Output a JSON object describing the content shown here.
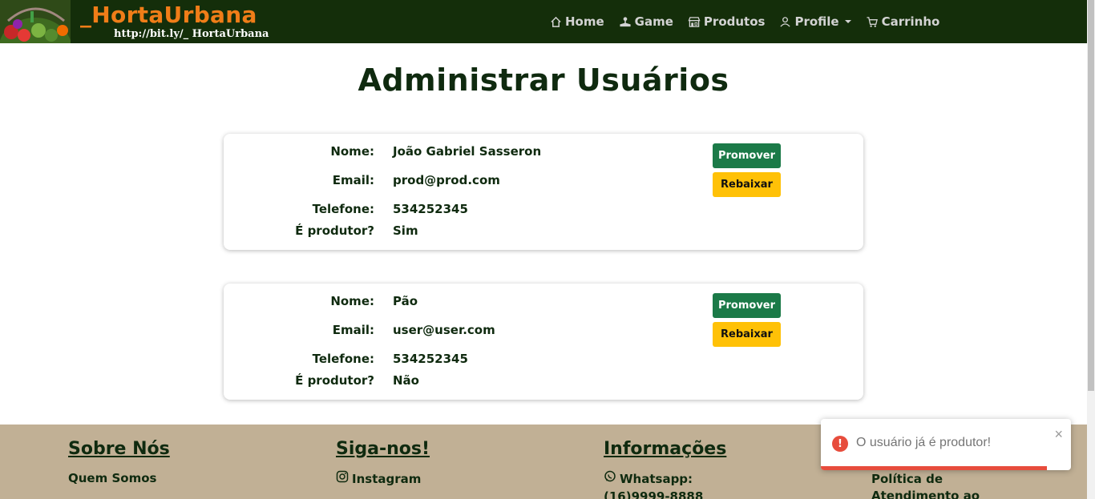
{
  "nav": {
    "logo_title": "_HortaUrbana",
    "logo_url": "http://bit.ly/_ HortaUrbana",
    "items": [
      {
        "label": "Home",
        "icon": "home-icon"
      },
      {
        "label": "Game",
        "icon": "joystick-icon"
      },
      {
        "label": "Produtos",
        "icon": "shop-icon"
      },
      {
        "label": "Profile",
        "icon": "person-icon"
      },
      {
        "label": "Carrinho",
        "icon": "cart-icon"
      }
    ]
  },
  "page_title": "Administrar Usuários",
  "field_labels": {
    "nome": "Nome:",
    "email": "Email:",
    "telefone": "Telefone:",
    "produtor": "É produtor?"
  },
  "buttons": {
    "promote": "Promover",
    "demote": "Rebaixar"
  },
  "users": [
    {
      "nome": "João Gabriel Sasseron",
      "email": "prod@prod.com",
      "telefone": "534252345",
      "produtor": "Sim"
    },
    {
      "nome": "Pão",
      "email": "user@user.com",
      "telefone": "534252345",
      "produtor": "Não"
    }
  ],
  "footer": {
    "col1": {
      "heading": "Sobre Nós",
      "link": "Quem Somos"
    },
    "col2": {
      "heading": "Siga-nos!",
      "link": "Instagram"
    },
    "col3": {
      "heading": "Informações",
      "link": "Whatsapp:",
      "phone": "(16)9999-8888"
    },
    "col4": {
      "line1": "Política de",
      "line2": "Atendimento ao"
    }
  },
  "toast": {
    "message": "O usuário já é produtor!",
    "close": "×",
    "icon": "!"
  },
  "colors": {
    "navbar": "#142e0a",
    "brand_orange": "#f07d18",
    "promote": "#1b7a48",
    "demote": "#ffc107",
    "footer": "#c1b095",
    "error": "#e74c3c"
  }
}
